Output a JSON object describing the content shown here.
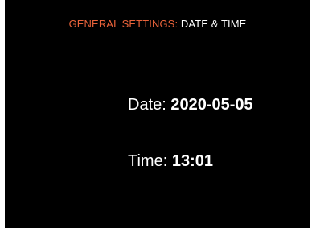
{
  "header": {
    "section": "GENERAL SETTINGS",
    "separator": ":",
    "page": "DATE & TIME"
  },
  "date": {
    "label": "Date:",
    "value": "2020-05-05"
  },
  "time": {
    "label": "Time:",
    "value": "13:01"
  },
  "colors": {
    "background": "#000000",
    "header_accent": "#e8623a",
    "text": "#ffffff"
  }
}
